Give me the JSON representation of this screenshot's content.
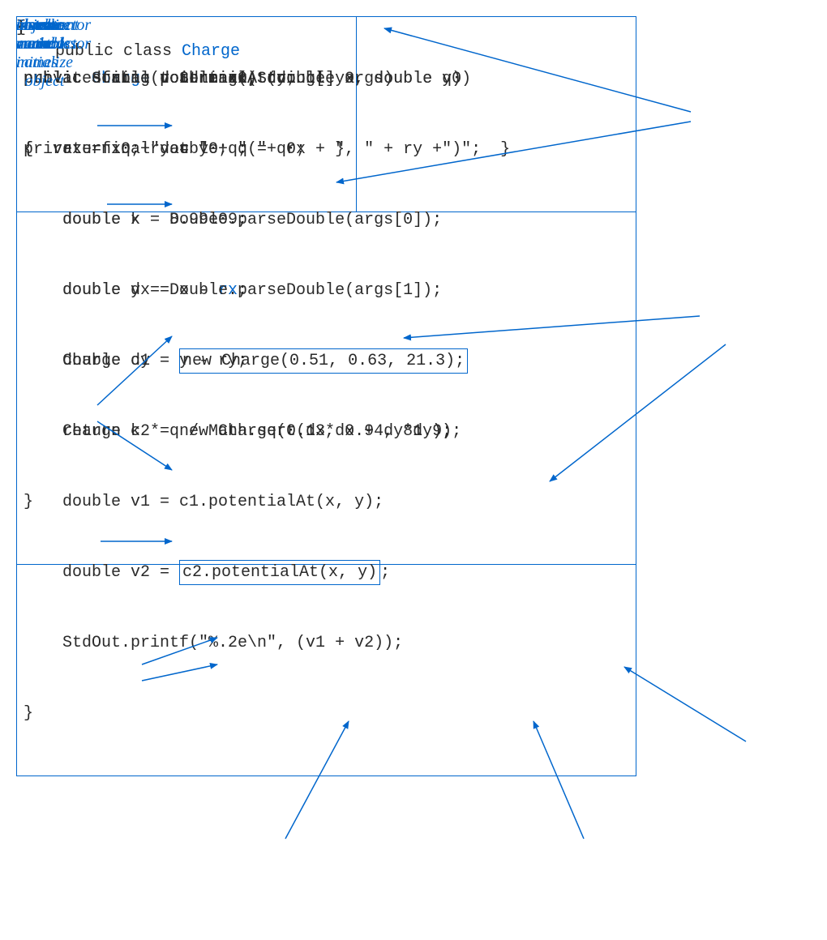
{
  "code": {
    "classDecl": {
      "prefix": "public class ",
      "name": "Charge",
      "brace": "{"
    },
    "instanceVars": {
      "line1": "private final double rx, ry;",
      "line2": "private final double q;"
    },
    "constructor": {
      "line1a": "public ",
      "line1b": "Charge",
      "line1c": "(double x0, double y0, double q0)",
      "line2": "{   rx = x0; ry = y0; q = q0;   }"
    },
    "potentialAt": {
      "line1": "public double potentialAt(double x, double y)",
      "line2": "{",
      "line3": "    double k = 8.99e09;",
      "line4a": "    double dx = x - ",
      "line4b": "rx",
      "line4c": ";",
      "line5": "    double dy = y - ry;",
      "line6": "    return k * q / Math.sqrt(dx*dx + dy*dy);",
      "line7": "}"
    },
    "toString": {
      "line1": "public String toString()",
      "line2": "{  return q +\" at \" + \"(\"+ rx + \", \" + ry +\")\";  }"
    },
    "main": {
      "line1": "public static void main(String[] args)",
      "line2": "{",
      "line3": "    double x = Double.parseDouble(args[0]);",
      "line4": "    double y = Double.parseDouble(args[1]);",
      "line5a": "    Charge c1 = ",
      "line5b": "new Charge(0.51, 0.63, 21.3);",
      "line6": "    Charge c2 = new Charge(0.13, 0.94, 81.9);",
      "line7": "    double v1 = c1.potentialAt(x, y);",
      "line8a": "    double v2 = ",
      "line8b": "c2.potentialAt(x, y)",
      "line8c": ";",
      "line9": "    StdOut.printf(\"%.2e\\n\", (v1 + v2));",
      "line10": "}"
    },
    "closeBrace": "}"
  },
  "labels": {
    "instanceVariables": "instance\nvariables",
    "constructor": "constructor",
    "instanceMethods": "instance\nmethods",
    "testClient": "test client",
    "createAndInitialize": "create\nand\ninitialize\nobject",
    "className": "class\nname",
    "instanceVariableNames": "instance\nvariable\nnames",
    "invokeConstructor": "invoke\nconstructor",
    "objectName": "object\nname",
    "invokeMethod": "invoke\nmethod"
  }
}
